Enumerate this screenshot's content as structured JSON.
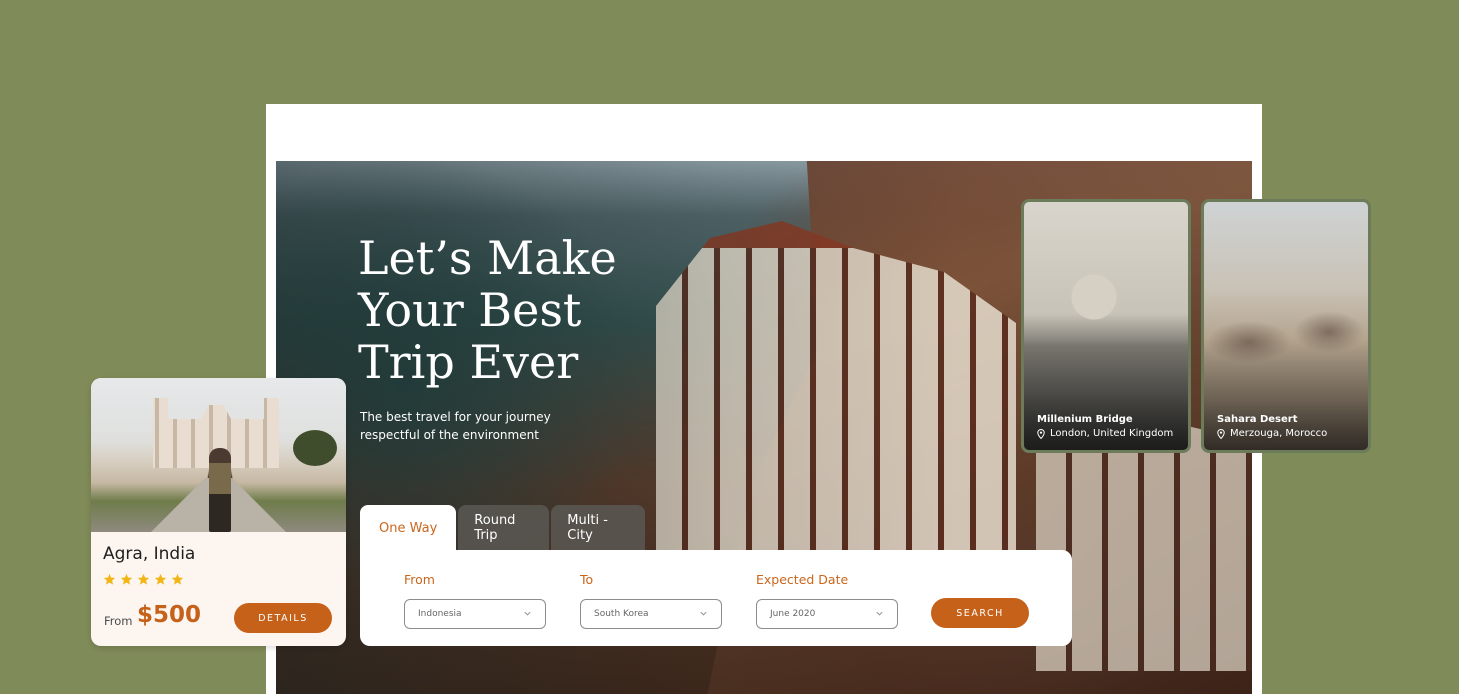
{
  "hero": {
    "headline": "Let’s Make Your Best Trip Ever",
    "subtitle": "The best travel for your journey respectful of the environment"
  },
  "booking": {
    "tabs": [
      {
        "label": "One Way",
        "active": true
      },
      {
        "label": "Round Trip",
        "active": false
      },
      {
        "label": "Multi - City",
        "active": false
      }
    ],
    "from_label": "From",
    "from_value": "Indonesia",
    "to_label": "To",
    "to_value": "South Korea",
    "date_label": "Expected Date",
    "date_value": "June 2020",
    "search_label": "SEARCH"
  },
  "destinations": [
    {
      "name": "Millenium Bridge",
      "location": "London, United Kingdom"
    },
    {
      "name": "Sahara Desert",
      "location": "Merzouga, Morocco"
    }
  ],
  "featured": {
    "title": "Agra, India",
    "rating": 5,
    "from_label": "From",
    "price": "$500",
    "button_label": "DETAILS"
  },
  "colors": {
    "background": "#7f8b58",
    "accent": "#c6611a",
    "star": "#f2b516"
  },
  "icons": [
    "chevron-down-icon",
    "location-pin-icon",
    "star-icon"
  ]
}
